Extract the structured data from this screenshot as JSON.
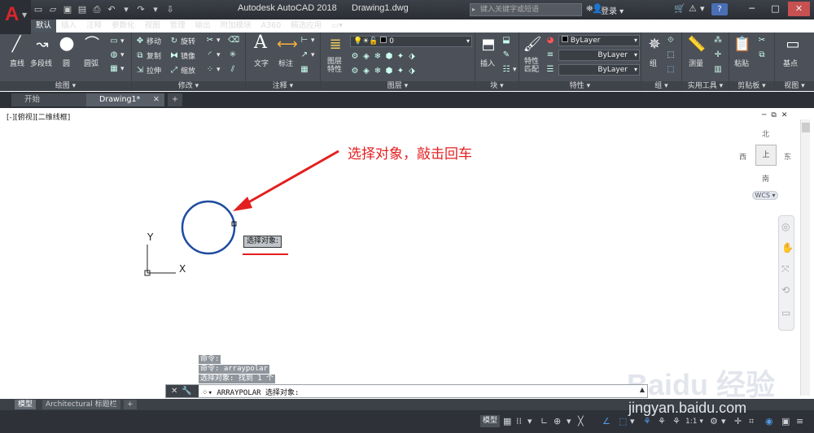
{
  "app": {
    "title": "Autodesk AutoCAD 2018",
    "document": "Drawing1.dwg",
    "logo": "A"
  },
  "search": {
    "placeholder": "键入关键字或短语"
  },
  "account": {
    "login": "登录"
  },
  "help": {
    "label": "?"
  },
  "ribbon_tabs": [
    "默认",
    "插入",
    "注释",
    "参数化",
    "视图",
    "管理",
    "输出",
    "附加模块",
    "A360",
    "精选应用"
  ],
  "ribbon": {
    "draw": {
      "title": "绘图",
      "line": "直线",
      "polyline": "多段线",
      "circle": "圆",
      "arc": "圆弧"
    },
    "modify": {
      "title": "修改",
      "move": "移动",
      "rotate": "旋转",
      "copy": "复制",
      "mirror": "镜像",
      "stretch": "拉伸",
      "scale": "缩放"
    },
    "annotation": {
      "title": "注释",
      "text": "文字",
      "dim": "标注"
    },
    "layers": {
      "title": "图层",
      "props": "图层特性",
      "layer_value": "0"
    },
    "block": {
      "title": "块",
      "insert": "插入"
    },
    "properties": {
      "title": "特性",
      "match": "特性匹配",
      "color": "ByLayer",
      "linetype": "ByLayer",
      "lineweight": "ByLayer"
    },
    "groups": {
      "title": "组",
      "group": "组"
    },
    "utilities": {
      "title": "实用工具",
      "measure": "测量"
    },
    "clipboard": {
      "title": "剪贴板",
      "paste": "粘贴"
    },
    "view": {
      "title": "视图",
      "base": "基点"
    }
  },
  "doc_tabs": {
    "start": "开始",
    "drawing": "Drawing1*",
    "add": "+"
  },
  "viewport": {
    "label": "[-][俯视][二维线框]"
  },
  "viewcube": {
    "north": "北",
    "south": "南",
    "east": "东",
    "west": "西",
    "top": "上",
    "wcs": "WCS"
  },
  "ucs": {
    "x": "X",
    "y": "Y"
  },
  "annotation_text": "选择对象，敲击回车",
  "tooltip": "选择对象:",
  "history": [
    "命令:",
    "命令:  arraypolar",
    "选择对象: 找到 1 个"
  ],
  "command_line": {
    "prompt": "ARRAYPOLAR 选择对象:"
  },
  "layout_tabs": [
    "模型",
    "Architectural 标题栏",
    "+"
  ],
  "status": {
    "model": "模型",
    "scale": "1:1"
  },
  "watermark": {
    "brand": "Baidu 经验",
    "url": "jingyan.baidu.com"
  }
}
